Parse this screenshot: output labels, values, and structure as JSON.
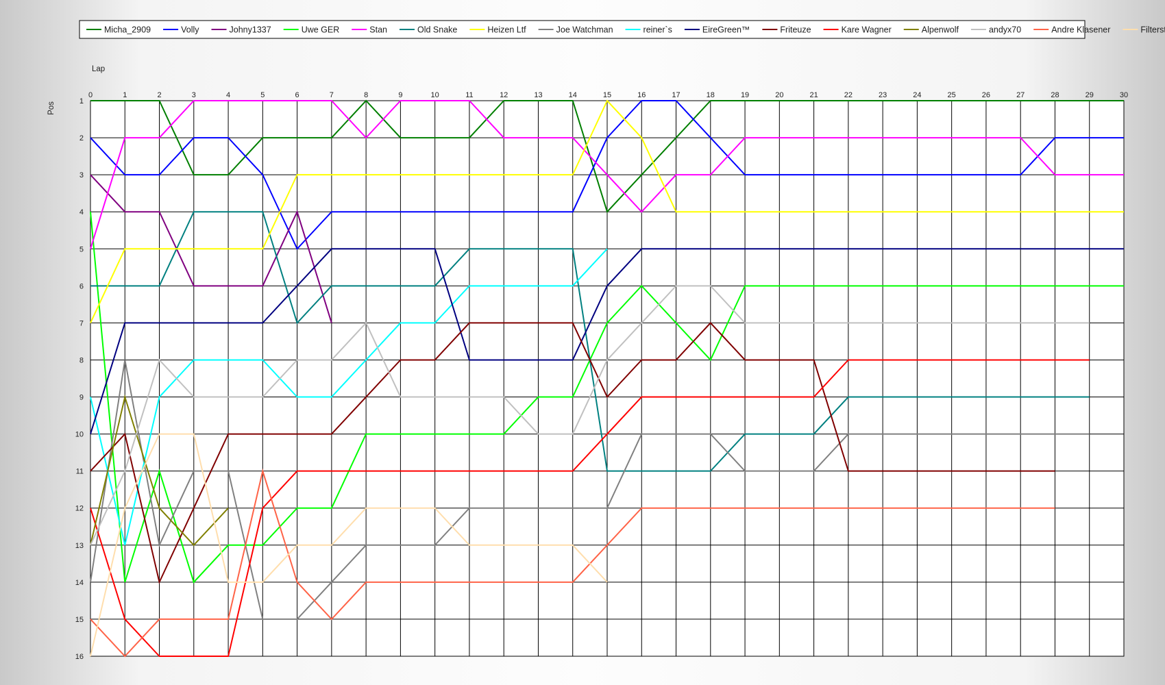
{
  "chart_data": {
    "type": "line",
    "xlabel": "Lap",
    "ylabel": "Pos",
    "x": [
      0,
      1,
      2,
      3,
      4,
      5,
      6,
      7,
      8,
      9,
      10,
      11,
      12,
      13,
      14,
      15,
      16,
      17,
      18,
      19,
      20,
      21,
      22,
      23,
      24,
      25,
      26,
      27,
      28,
      29,
      30
    ],
    "xlim": [
      0,
      30
    ],
    "ylim": [
      1,
      16
    ],
    "y_inverted": true,
    "y_ticks": [
      1,
      2,
      3,
      4,
      5,
      6,
      7,
      8,
      9,
      10,
      11,
      12,
      13,
      14,
      15,
      16
    ],
    "grid": true,
    "legend_position": "top",
    "series": [
      {
        "name": "Micha_2909",
        "color": "#007F00",
        "values": [
          1,
          1,
          1,
          3,
          3,
          2,
          2,
          2,
          1,
          2,
          2,
          2,
          1,
          1,
          1,
          4,
          3,
          2,
          1,
          1,
          1,
          1,
          1,
          1,
          1,
          1,
          1,
          1,
          1,
          1,
          1
        ]
      },
      {
        "name": "Volly",
        "color": "#0000FF",
        "values": [
          2,
          3,
          3,
          2,
          2,
          3,
          5,
          4,
          4,
          4,
          4,
          4,
          4,
          4,
          4,
          2,
          1,
          1,
          2,
          3,
          3,
          3,
          3,
          3,
          3,
          3,
          3,
          3,
          2,
          2,
          2
        ]
      },
      {
        "name": "Johny1337",
        "color": "#800080",
        "values": [
          3,
          4,
          4,
          6,
          6,
          6,
          4,
          7
        ]
      },
      {
        "name": "Uwe GER",
        "color": "#00FF00",
        "values": [
          4,
          14,
          11,
          14,
          13,
          13,
          12,
          12,
          10,
          10,
          10,
          10,
          10,
          9,
          9,
          7,
          6,
          7,
          8,
          6,
          6,
          6,
          6,
          6,
          6,
          6,
          6,
          6,
          6,
          6,
          6
        ]
      },
      {
        "name": "Stan",
        "color": "#FF00FF",
        "values": [
          5,
          2,
          2,
          1,
          1,
          1,
          1,
          1,
          2,
          1,
          1,
          1,
          2,
          2,
          2,
          3,
          4,
          3,
          3,
          2,
          2,
          2,
          2,
          2,
          2,
          2,
          2,
          2,
          3,
          3,
          3
        ]
      },
      {
        "name": "Old Snake",
        "color": "#008080",
        "values": [
          6,
          6,
          6,
          4,
          4,
          4,
          7,
          6,
          6,
          6,
          6,
          5,
          5,
          5,
          5,
          11,
          11,
          11,
          11,
          10,
          10,
          10,
          9,
          9,
          9,
          9,
          9,
          9,
          9,
          9
        ]
      },
      {
        "name": "Heizen Ltf",
        "color": "#FFFF00",
        "values": [
          7,
          5,
          5,
          5,
          5,
          5,
          3,
          3,
          3,
          3,
          3,
          3,
          3,
          3,
          3,
          1,
          2,
          4,
          4,
          4,
          4,
          4,
          4,
          4,
          4,
          4,
          4,
          4,
          4,
          4,
          4
        ]
      },
      {
        "name": "Joe Watchman",
        "color": "#808080",
        "values": [
          14,
          8,
          13,
          11,
          11,
          15,
          15,
          14,
          13,
          13,
          13,
          12,
          12,
          12,
          12,
          12,
          10,
          10,
          10,
          11,
          11,
          11,
          10,
          10,
          10,
          10,
          10,
          10,
          10,
          10
        ]
      },
      {
        "name": "reiner`s",
        "color": "#00FFFF",
        "values": [
          9,
          13,
          9,
          8,
          8,
          8,
          9,
          9,
          8,
          7,
          7,
          6,
          6,
          6,
          6,
          5
        ]
      },
      {
        "name": "EireGreen™",
        "color": "#000080",
        "values": [
          10,
          7,
          7,
          7,
          7,
          7,
          6,
          5,
          5,
          5,
          5,
          8,
          8,
          8,
          8,
          6,
          5,
          5,
          5,
          5,
          5,
          5,
          5,
          5,
          5,
          5,
          5,
          5,
          5,
          5,
          5
        ]
      },
      {
        "name": "Friteuze",
        "color": "#800000",
        "values": [
          11,
          10,
          14,
          12,
          10,
          10,
          10,
          10,
          9,
          8,
          8,
          7,
          7,
          7,
          7,
          9,
          8,
          8,
          7,
          8,
          8,
          8,
          11,
          11,
          11,
          11,
          11,
          11,
          11
        ]
      },
      {
        "name": "Kare Wagner",
        "color": "#FF0000",
        "values": [
          12,
          15,
          16,
          16,
          16,
          12,
          11,
          11,
          11,
          11,
          11,
          11,
          11,
          11,
          11,
          10,
          9,
          9,
          9,
          9,
          9,
          9,
          8,
          8,
          8,
          8,
          8,
          8,
          8,
          8
        ]
      },
      {
        "name": "Alpenwolf",
        "color": "#808000",
        "values": [
          13,
          9,
          12,
          13,
          12
        ]
      },
      {
        "name": "andyx70",
        "color": "#C0C0C0",
        "values": [
          13,
          11,
          8,
          9,
          9,
          9,
          8,
          8,
          7,
          9,
          9,
          9,
          9,
          10,
          10,
          8,
          7,
          6,
          6,
          7,
          7,
          7,
          7,
          7,
          7,
          7,
          7,
          7,
          7,
          7
        ]
      },
      {
        "name": "Andre Klasener",
        "color": "#FF6347",
        "values": [
          15,
          16,
          15,
          15,
          15,
          11,
          14,
          15,
          14,
          14,
          14,
          14,
          14,
          14,
          14,
          13,
          12,
          12,
          12,
          12,
          12,
          12,
          12,
          12,
          12,
          12,
          12,
          12,
          12
        ]
      },
      {
        "name": "Filterstony",
        "color": "#FFDEAD",
        "values": [
          16,
          12,
          10,
          10,
          14,
          14,
          13,
          13,
          12,
          12,
          12,
          13,
          13,
          13,
          13,
          14
        ]
      }
    ]
  }
}
